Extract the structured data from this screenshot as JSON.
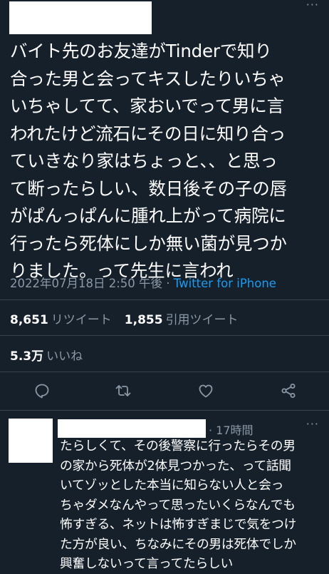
{
  "tweet": {
    "more": "···",
    "text": "バイト先のお友達がTinderで知り\n合った男と会ってキスしたりいちゃ\nいちゃしてて、家おいでって男に言\nわれたけど流石にその日に知り合っ\nていきなり家はちょっと、、と思っ\nて断ったらしい、数日後その子の唇\nがぱんっぱんに腫れ上がって病院に\n行ったら死体にしか無い菌が見つか\nりました。って先生に言われ",
    "timestamp": "2022年07月18日 2:50 午後",
    "separator": " · ",
    "source": "Twitter for iPhone"
  },
  "stats": {
    "retweets_count": "8,651",
    "retweets_label": "リツイート",
    "quotes_count": "1,855",
    "quotes_label": "引用ツイート",
    "likes_count": "5.3万",
    "likes_label": "いいね"
  },
  "reply": {
    "time": "· 17時間",
    "more": "···",
    "text": "たらしくて、その後警察に行ったらその男\nの家から死体が2体見つかった、って話聞\nいてゾッとした本当に知らない人と会っ\nちゃダメなんやって思ったいくらなんでも\n怖すぎる、ネットは怖すぎまじで気をつけ\nた方が良い、ちなみにその男は死体でしか\n興奮しないって言ってたらしい"
  },
  "colors": {
    "background": "#15202b",
    "secondary_text": "#8b98a5",
    "accent": "#1d9bf0",
    "divider": "#38444d"
  },
  "icons": [
    "reply-icon",
    "retweet-icon",
    "like-icon",
    "share-icon",
    "more-icon"
  ]
}
